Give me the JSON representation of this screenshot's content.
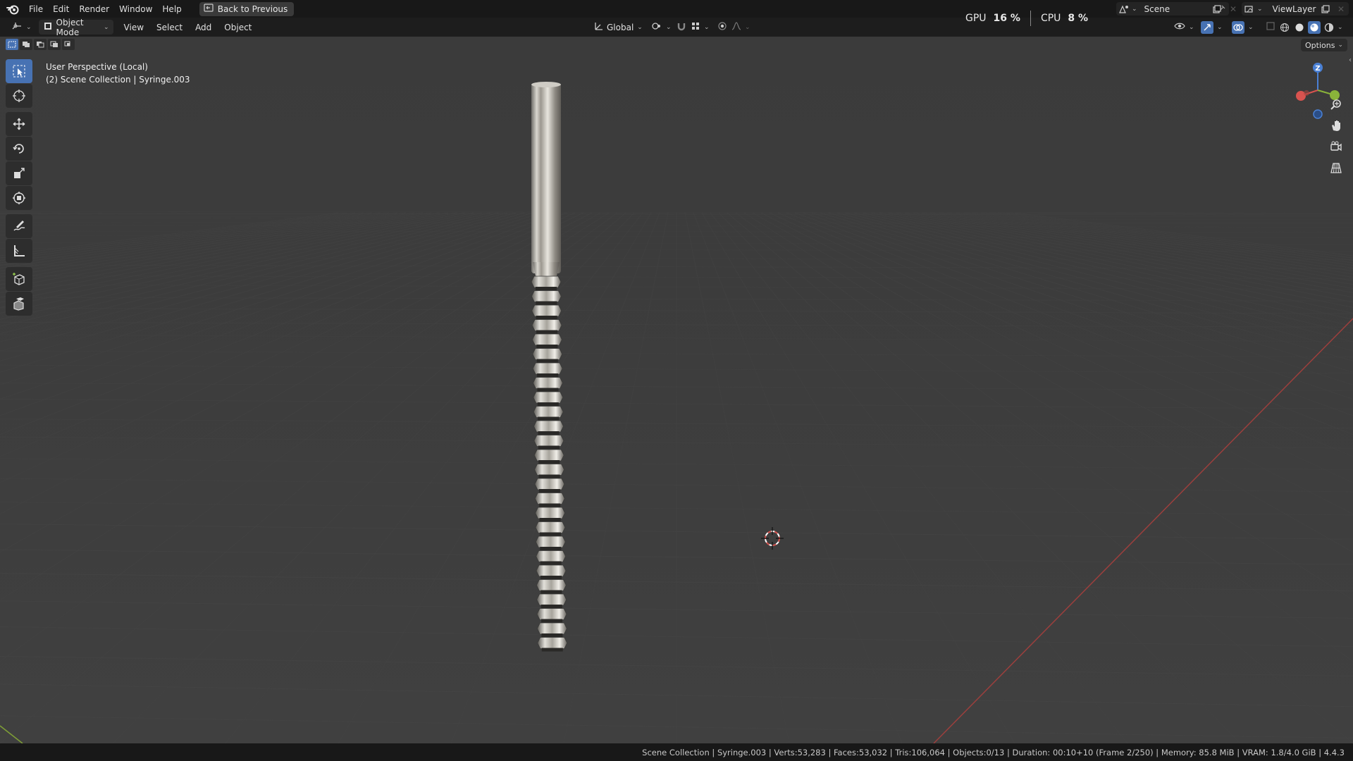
{
  "menubar": {
    "logo": "blender-logo-icon",
    "items": [
      "File",
      "Edit",
      "Render",
      "Window",
      "Help"
    ],
    "back_button": "Back to Previous"
  },
  "perf": {
    "gpu_label": "GPU",
    "gpu_value": "16 %",
    "cpu_label": "CPU",
    "cpu_value": "8 %"
  },
  "scene": {
    "name": "Scene"
  },
  "view_layer": {
    "name": "ViewLayer"
  },
  "header": {
    "mode": "Object Mode",
    "menus": [
      "View",
      "Select",
      "Add",
      "Object"
    ],
    "transform_orientation": "Global"
  },
  "viewport": {
    "title": "User Perspective (Local)",
    "subtitle": "(2) Scene Collection | Syringe.003",
    "options_label": "Options",
    "gizmo_axis_label": "Z",
    "background_color": "#3d3d3d",
    "accent_color": "#4772b3",
    "x_axis_color": "#b0423f",
    "y_axis_color": "#8ab33a"
  },
  "toolbar": {
    "tools": [
      "select-box-icon",
      "cursor-icon",
      "move-icon",
      "rotate-icon",
      "scale-icon",
      "transform-icon",
      "annotate-icon",
      "measure-icon",
      "add-cube-icon",
      "extrude-cube-icon"
    ],
    "active": "select-box-icon"
  },
  "statusbar": {
    "text": "Scene Collection | Syringe.003 | Verts:53,283 | Faces:53,032 | Tris:106,064 | Objects:0/13 | Duration: 00:10+10 (Frame 2/250) | Memory: 85.8 MiB | VRAM: 1.8/4.0 GiB | 4.4.3"
  }
}
